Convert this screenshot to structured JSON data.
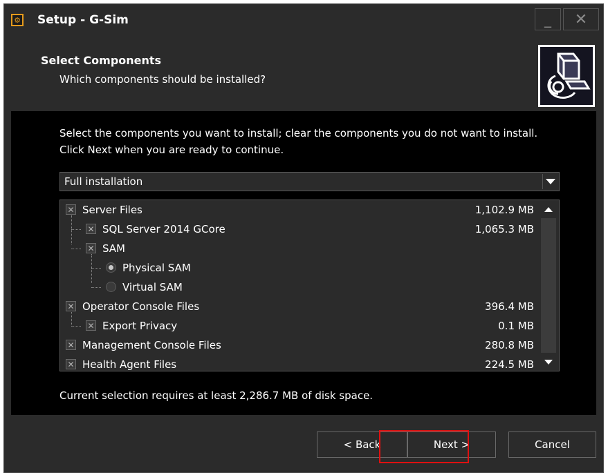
{
  "window": {
    "title": "Setup - G-Sim",
    "minimize_glyph": "_",
    "close_glyph": "✕"
  },
  "header": {
    "heading": "Select Components",
    "subheading": "Which components should be installed?"
  },
  "instructions": "Select the components you want to install; clear the components you do not want to install. Click Next when you are ready to continue.",
  "install_type": {
    "selected": "Full installation"
  },
  "components": [
    {
      "label": "Server Files",
      "size": "1,102.9 MB",
      "kind": "checkbox",
      "level": 0,
      "checked": true
    },
    {
      "label": "SQL Server 2014 GCore",
      "size": "1,065.3 MB",
      "kind": "checkbox",
      "level": 1,
      "checked": true
    },
    {
      "label": "SAM",
      "size": "",
      "kind": "checkbox",
      "level": 1,
      "checked": true
    },
    {
      "label": "Physical SAM",
      "size": "",
      "kind": "radio",
      "level": 2,
      "checked": true
    },
    {
      "label": "Virtual SAM",
      "size": "",
      "kind": "radio",
      "level": 2,
      "checked": false
    },
    {
      "label": "Operator Console Files",
      "size": "396.4 MB",
      "kind": "checkbox",
      "level": 0,
      "checked": true
    },
    {
      "label": "Export Privacy",
      "size": "0.1 MB",
      "kind": "checkbox",
      "level": 1,
      "checked": true
    },
    {
      "label": "Management Console Files",
      "size": "280.8 MB",
      "kind": "checkbox",
      "level": 0,
      "checked": true
    },
    {
      "label": "Health Agent Files",
      "size": "224.5 MB",
      "kind": "checkbox",
      "level": 0,
      "checked": true
    }
  ],
  "disk_space": "Current selection requires at least 2,286.7 MB of disk space.",
  "buttons": {
    "back": "< Back",
    "next": "Next >",
    "cancel": "Cancel"
  },
  "colors": {
    "window_bg": "#2b2b2b",
    "panel_bg": "#000000",
    "accent_icon": "#e59a1c",
    "highlight": "#e01010"
  },
  "icons": {
    "app": "setup-gear-icon",
    "header": "computer-install-icon"
  }
}
